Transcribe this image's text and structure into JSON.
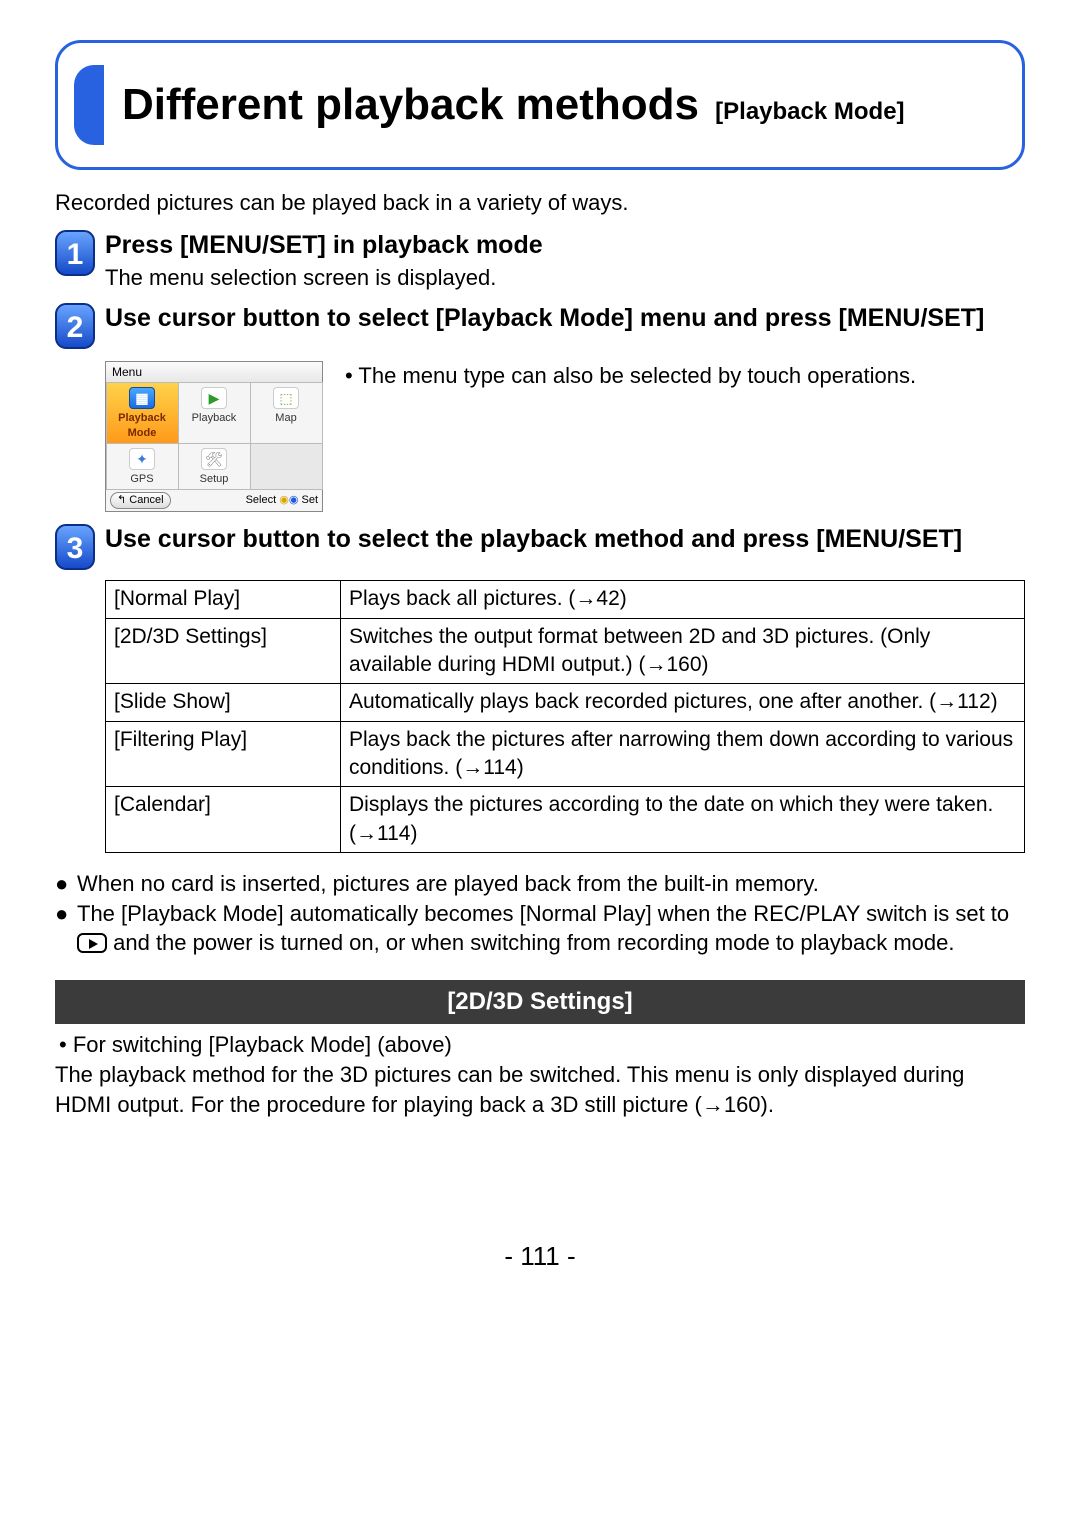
{
  "title": {
    "main": "Different playback methods",
    "sub": "[Playback Mode]"
  },
  "intro": "Recorded pictures can be played back in a variety of ways.",
  "steps": {
    "s1": {
      "title": "Press [MENU/SET] in playback mode",
      "desc": "The menu selection screen is displayed."
    },
    "s2": {
      "title": "Use cursor button to select [Playback Mode] menu and press [MENU/SET]",
      "touch_note": "• The menu type can also be selected by touch operations."
    },
    "s3": {
      "title": "Use cursor button to select the playback method and press [MENU/SET]"
    }
  },
  "menu_mock": {
    "header": "Menu",
    "cells": {
      "playback_mode": "Playback\nMode",
      "playback": "Playback",
      "map": "Map",
      "gps": "GPS",
      "setup": "Setup"
    },
    "footer": {
      "cancel": "↰ Cancel",
      "select": "Select",
      "set": "Set"
    }
  },
  "methods": [
    {
      "name": "[Normal Play]",
      "desc": "Plays back all pictures. (→42)"
    },
    {
      "name": "[2D/3D Settings]",
      "desc": "Switches the output format between 2D and 3D pictures. (Only available during HDMI output.) (→160)"
    },
    {
      "name": "[Slide Show]",
      "desc": "Automatically plays back recorded pictures, one after another. (→112)"
    },
    {
      "name": "[Filtering Play]",
      "desc": "Plays back the pictures after narrowing them down according to various conditions. (→114)"
    },
    {
      "name": "[Calendar]",
      "desc": "Displays the pictures according to the date on which they were taken. (→114)"
    }
  ],
  "notes": {
    "n1": "When no card is inserted, pictures are played back from the built-in memory.",
    "n2a": "The [Playback Mode] automatically becomes [Normal Play] when the REC/PLAY switch is set to ",
    "n2b": " and the power is turned on, or when switching from recording mode to playback mode."
  },
  "section": {
    "heading": "[2D/3D Settings]",
    "bullet": "• For switching [Playback Mode] (above)",
    "body": "The playback method for the 3D pictures can be switched. This menu is only displayed during HDMI output. For the procedure for playing back a 3D still picture (→160)."
  },
  "page_number": "- 111 -"
}
